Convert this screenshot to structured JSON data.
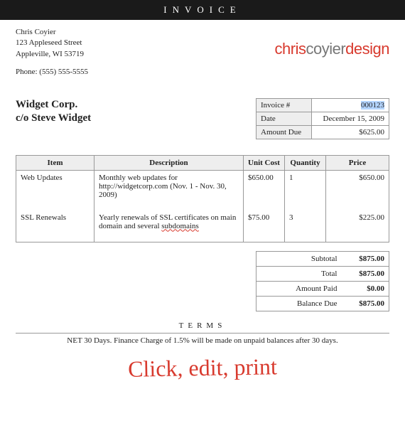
{
  "header": {
    "title": "INVOICE"
  },
  "sender": {
    "name": "Chris Coyier",
    "street": "123 Appleseed Street",
    "city": "Appleville, WI 53719",
    "phone_label": "Phone: (555) 555-5555"
  },
  "logo": {
    "part1": "chris",
    "part2": "coyier",
    "part3": "design"
  },
  "client": {
    "line1": "Widget Corp.",
    "line2": "c/o Steve Widget"
  },
  "meta": {
    "invoice_label": "Invoice #",
    "invoice_value": "000123",
    "date_label": "Date",
    "date_value": "December 15, 2009",
    "due_label": "Amount Due",
    "due_value": "$625.00"
  },
  "columns": {
    "item": "Item",
    "desc": "Description",
    "cost": "Unit Cost",
    "qty": "Quantity",
    "price": "Price"
  },
  "items": [
    {
      "item": "Web Updates",
      "desc": "Monthly web updates for http://widgetcorp.com (Nov. 1 - Nov. 30, 2009)",
      "cost": "$650.00",
      "qty": "1",
      "price": "$650.00"
    },
    {
      "item": "SSL Renewals",
      "desc_pre": "Yearly renewals of SSL certificates on main domain and several ",
      "desc_marked": "subdomains",
      "cost": "$75.00",
      "qty": "3",
      "price": "$225.00"
    }
  ],
  "totals": {
    "subtotal_label": "Subtotal",
    "subtotal_value": "$875.00",
    "total_label": "Total",
    "total_value": "$875.00",
    "paid_label": "Amount Paid",
    "paid_value": "$0.00",
    "balance_label": "Balance Due",
    "balance_value": "$875.00"
  },
  "terms": {
    "header": "TERMS",
    "text": "NET 30 Days. Finance Charge of 1.5% will be made on unpaid balances after 30 days."
  },
  "annotation": "Click, edit, print"
}
